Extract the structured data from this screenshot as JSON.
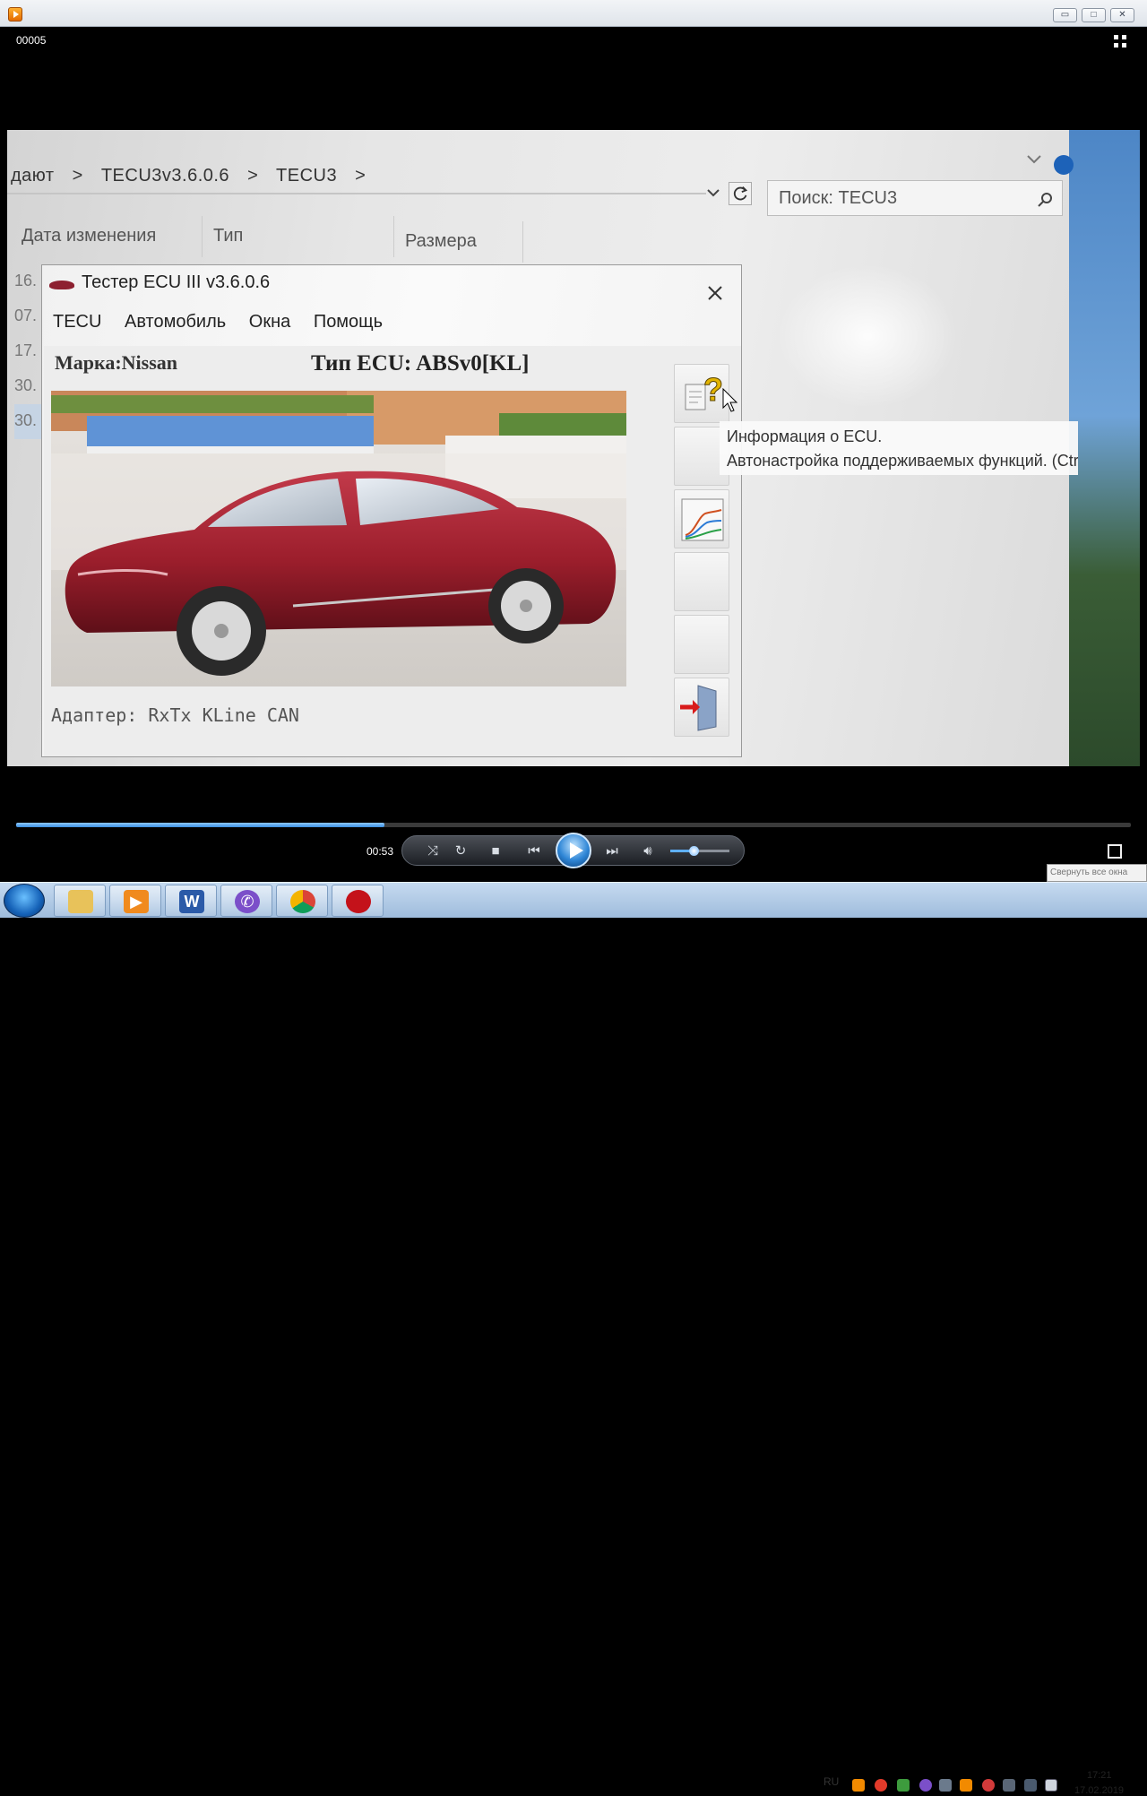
{
  "player": {
    "counter": "00005",
    "time": "00:53",
    "progress_fraction": 0.33,
    "volume_fraction": 0.4,
    "window_buttons": {
      "minimize": "▭",
      "maximize": "□",
      "close": "✕"
    }
  },
  "explorer": {
    "breadcrumb": [
      "дают",
      ">",
      "TECU3v3.6.0.6",
      ">",
      "TECU3",
      ">"
    ],
    "search_placeholder": "Поиск: TECU3",
    "columns": [
      "Дата изменения",
      "Тип",
      "Размера"
    ],
    "row_snips": [
      "16.",
      "07.",
      "17.",
      "30.",
      "30."
    ]
  },
  "tecu": {
    "title": "Тестер ECU III v3.6.0.6",
    "menu": [
      "TECU",
      "Автомобиль",
      "Окна",
      "Помощь"
    ],
    "make_label": "Марка:Nissan",
    "ecu_type_label": "Тип ECU: ABSv0[KL]",
    "adapter_label": "Адаптер: RxTx KLine CAN",
    "tooltip_line1": "Информация о ECU.",
    "tooltip_line2": "Автонастройка поддерживаемых функций. (Ctrl + I)",
    "car_color": "#9c1e2c"
  },
  "taskbar": {
    "language": "RU",
    "time": "17:21",
    "date": "17.02.2019",
    "show_desktop_tooltip": "Свернуть все окна"
  }
}
